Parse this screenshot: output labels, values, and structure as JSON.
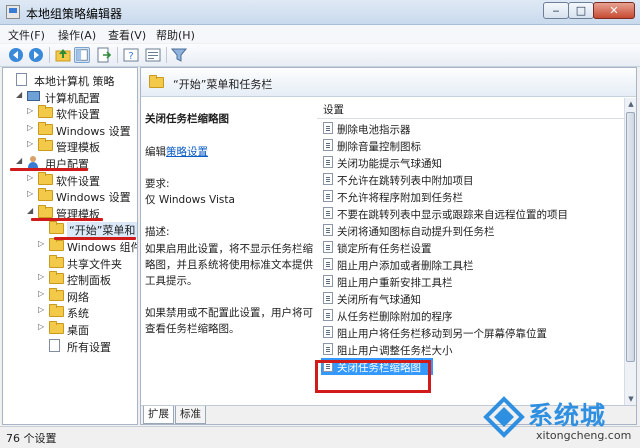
{
  "window": {
    "title": "本地组策略编辑器",
    "min": "‒",
    "max": "□",
    "close": "✕"
  },
  "menu": [
    "文件(F)",
    "操作(A)",
    "查看(V)",
    "帮助(H)"
  ],
  "toolbar_icons": [
    "back-icon",
    "forward-icon",
    "up-folder-icon",
    "show-tree-icon",
    "export-icon",
    "help-icon",
    "properties-icon",
    "filter-icon"
  ],
  "tree": [
    {
      "label": "本地计算机 策略",
      "indent": 0,
      "expander": "",
      "icon": "doc"
    },
    {
      "label": "计算机配置",
      "indent": 1,
      "expander": "◢",
      "icon": "pc"
    },
    {
      "label": "软件设置",
      "indent": 2,
      "expander": "▷",
      "icon": "folder"
    },
    {
      "label": "Windows 设置",
      "indent": 2,
      "expander": "▷",
      "icon": "folder"
    },
    {
      "label": "管理模板",
      "indent": 2,
      "expander": "▷",
      "icon": "folder"
    },
    {
      "label": "用户配置",
      "indent": 1,
      "expander": "◢",
      "icon": "user"
    },
    {
      "label": "软件设置",
      "indent": 2,
      "expander": "▷",
      "icon": "folder"
    },
    {
      "label": "Windows 设置",
      "indent": 2,
      "expander": "▷",
      "icon": "folder"
    },
    {
      "label": "管理模板",
      "indent": 2,
      "expander": "◢",
      "icon": "folder"
    },
    {
      "label": "“开始”菜单和",
      "indent": 3,
      "expander": "",
      "icon": "folder",
      "selected": true
    },
    {
      "label": "Windows 组件",
      "indent": 3,
      "expander": "▷",
      "icon": "folder"
    },
    {
      "label": "共享文件夹",
      "indent": 3,
      "expander": "",
      "icon": "folder"
    },
    {
      "label": "控制面板",
      "indent": 3,
      "expander": "▷",
      "icon": "folder"
    },
    {
      "label": "网络",
      "indent": 3,
      "expander": "▷",
      "icon": "folder"
    },
    {
      "label": "系统",
      "indent": 3,
      "expander": "▷",
      "icon": "folder"
    },
    {
      "label": "桌面",
      "indent": 3,
      "expander": "▷",
      "icon": "folder"
    },
    {
      "label": "所有设置",
      "indent": 3,
      "expander": "",
      "icon": "doc"
    }
  ],
  "header": {
    "title": "“开始”菜单和任务栏"
  },
  "description": {
    "policy_title": "关闭任务栏缩略图",
    "edit_prefix": "编辑",
    "edit_link": "策略设置",
    "req_label": "要求:",
    "req_value": "仅 Windows Vista",
    "desc_label": "描述:",
    "lines": [
      "如果启用此设置，将不显示任务栏缩",
      "略图，并且系统将使用标准文本提供",
      "工具提示。",
      "",
      "如果禁用或不配置此设置，用户将可",
      "查看任务栏缩略图。"
    ]
  },
  "list": {
    "header": "设置",
    "items": [
      "删除电池指示器",
      "删除音量控制图标",
      "关闭功能提示气球通知",
      "不允许在跳转列表中附加项目",
      "不允许将程序附加到任务栏",
      "不要在跳转列表中显示或跟踪来自远程位置的项目",
      "关闭将通知图标自动提升到任务栏",
      "锁定所有任务栏设置",
      "阻止用户添加或者删除工具栏",
      "阻止用户重新安排工具栏",
      "关闭所有气球通知",
      "从任务栏删除附加的程序",
      "阻止用户将任务栏移动到另一个屏幕停靠位置",
      "阻止用户调整任务栏大小",
      "关闭任务栏缩略图"
    ],
    "selected_index": 14
  },
  "tabs": [
    "扩展",
    "标准"
  ],
  "status": "76 个设置",
  "watermark": {
    "title": "系统城",
    "url": "xitongcheng.com"
  },
  "colors": {
    "accent": "#3a7bd5",
    "annotation": "#d11a1a",
    "selection": "#3399ff"
  }
}
